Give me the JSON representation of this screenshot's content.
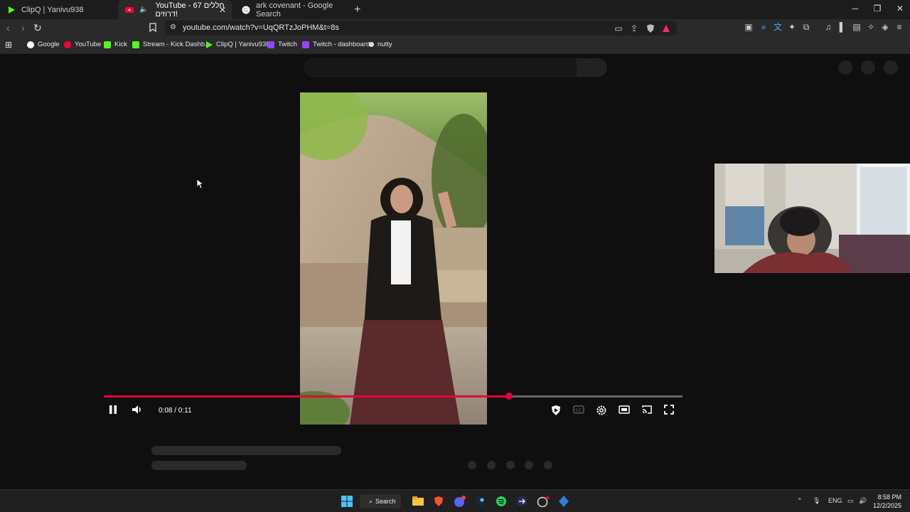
{
  "tabs": [
    {
      "title": "ClipQ | Yanivu938"
    },
    {
      "title": "YouTube - 67 חללים דרוזים!"
    },
    {
      "title": "ark covenant - Google Search"
    }
  ],
  "address": {
    "url": "youtube.com/watch?v=UqQRTzJoPHM&t=8s"
  },
  "bookmarks": [
    {
      "label": "Google"
    },
    {
      "label": "YouTube"
    },
    {
      "label": "Kick"
    },
    {
      "label": "Stream - Kick Dashb..."
    },
    {
      "label": "ClipQ | Yanivu938"
    },
    {
      "label": "Twitch"
    },
    {
      "label": "Twitch - dashboard"
    },
    {
      "label": "nutty"
    }
  ],
  "player": {
    "time": "0:08 / 0:11",
    "progress_fraction": 0.7,
    "accent": "#e4003a"
  },
  "taskbar": {
    "search_label": "Search",
    "lang": "ENG",
    "time": "8:58 PM",
    "date": "12/2/2025"
  },
  "colors": {
    "page_bg": "#0f0f0f",
    "chrome_bg": "#2a2a2a"
  }
}
